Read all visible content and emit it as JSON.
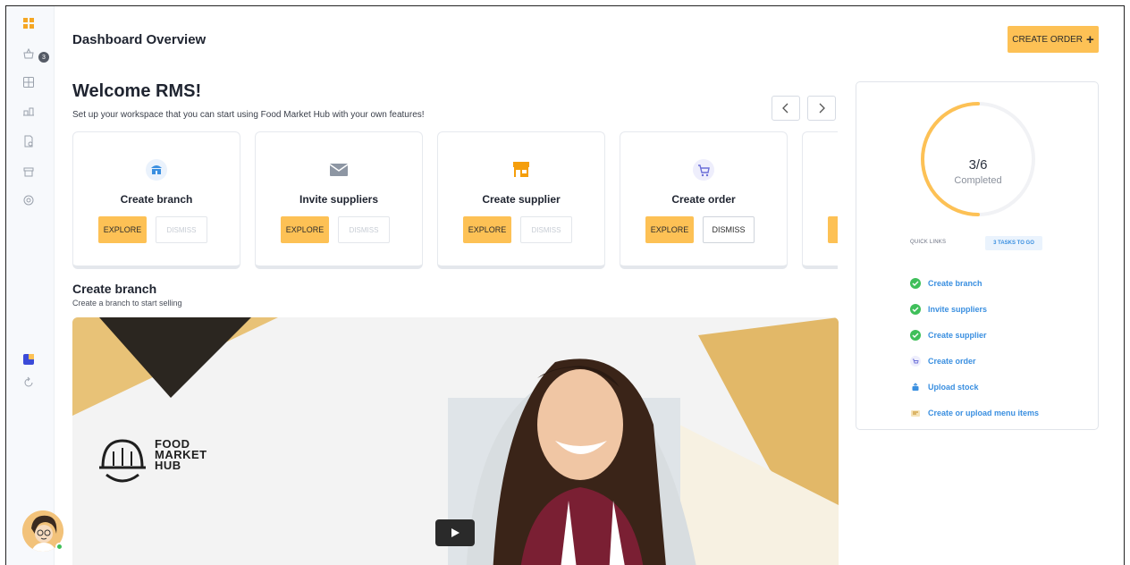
{
  "header": {
    "title": "Dashboard Overview",
    "create_order_label": "CREATE ORDER",
    "create_order_icon": "+"
  },
  "sidebar": {
    "items": [
      {
        "icon": "dashboard-icon"
      },
      {
        "icon": "basket-icon",
        "badge": "3"
      },
      {
        "icon": "grid-icon"
      },
      {
        "icon": "supplier-icon"
      },
      {
        "icon": "document-icon"
      },
      {
        "icon": "store-icon"
      },
      {
        "icon": "settings-icon"
      }
    ],
    "bottom": [
      {
        "icon": "app-icon"
      },
      {
        "icon": "refresh-icon"
      }
    ]
  },
  "welcome": {
    "title": "Welcome RMS!",
    "subtitle": "Set up your workspace that you can start using Food Market Hub with your own features!"
  },
  "cards": [
    {
      "title": "Create branch",
      "icon": "branch-icon",
      "explore": "EXPLORE",
      "dismiss": "DISMISS",
      "dismiss_enabled": false
    },
    {
      "title": "Invite suppliers",
      "icon": "mail-icon",
      "explore": "EXPLORE",
      "dismiss": "DISMISS",
      "dismiss_enabled": false
    },
    {
      "title": "Create supplier",
      "icon": "store-icon",
      "explore": "EXPLORE",
      "dismiss": "DISMISS",
      "dismiss_enabled": false
    },
    {
      "title": "Create order",
      "icon": "cart-icon",
      "explore": "EXPLORE",
      "dismiss": "DISMISS",
      "dismiss_enabled": true
    }
  ],
  "section": {
    "title": "Create branch",
    "subtitle": "Create a branch to start selling"
  },
  "video": {
    "logo_line1": "FOOD",
    "logo_line2": "MARKET",
    "logo_line3": "HUB"
  },
  "progress": {
    "value": "3/6",
    "label": "Completed",
    "fraction": 0.5,
    "quick_links_label": "QUICK LINKS",
    "tasks_badge": "3 TASKS TO GO",
    "tasks": [
      {
        "label": "Create branch",
        "done": true
      },
      {
        "label": "Invite suppliers",
        "done": true
      },
      {
        "label": "Create supplier",
        "done": true
      },
      {
        "label": "Create order",
        "done": false,
        "icon": "cart-icon"
      },
      {
        "label": "Upload stock",
        "done": false,
        "icon": "upload-icon"
      },
      {
        "label": "Create or upload menu items",
        "done": false,
        "icon": "menu-icon"
      }
    ]
  },
  "colors": {
    "accent": "#fdc155",
    "link": "#3a8fe0",
    "success": "#3fbf5a"
  }
}
